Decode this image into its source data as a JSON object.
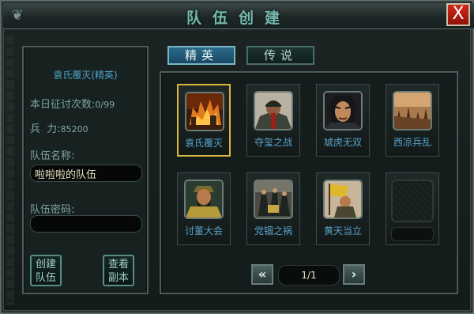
{
  "window": {
    "title": "队伍创建",
    "close_label": "X",
    "corner_icon": "dragon-ornament-icon"
  },
  "tabs": [
    {
      "label": "精英",
      "selected": true
    },
    {
      "label": "传说",
      "selected": false
    }
  ],
  "info": {
    "dungeon_name": "袁氏覆灭(精英)",
    "daily_label": "本日征讨次数:",
    "daily_value": "0/99",
    "troops_label": "兵  力:",
    "troops_value": "85200",
    "team_name_label": "队伍名称:",
    "team_name_value": "啦啦啦的队伍",
    "team_password_label": "队伍密码:",
    "team_password_value": "",
    "create_button_line1": "创建",
    "create_button_line2": "队伍",
    "view_button_line1": "查看",
    "view_button_line2": "副本"
  },
  "dungeons": [
    {
      "name": "袁氏覆灭",
      "selected": true,
      "icon": "burning-city-icon"
    },
    {
      "name": "夺玺之战",
      "selected": false,
      "icon": "armored-general-icon"
    },
    {
      "name": "虓虎无双",
      "selected": false,
      "icon": "warrior-portrait-icon"
    },
    {
      "name": "西凉兵乱",
      "selected": false,
      "icon": "soldiers-battle-icon"
    },
    {
      "name": "讨董大会",
      "selected": false,
      "icon": "bearded-general-icon"
    },
    {
      "name": "党锢之祸",
      "selected": false,
      "icon": "officials-court-icon"
    },
    {
      "name": "黄天当立",
      "selected": false,
      "icon": "yellow-banner-icon"
    },
    {
      "name": "",
      "selected": false,
      "icon": "locked-slot-icon"
    }
  ],
  "pagination": {
    "page_text": "1/1",
    "prev_icon": "double-chevron-left-icon",
    "next_icon": "chevron-right-icon"
  },
  "colors": {
    "accent_title": "#79b7b0",
    "selected_border": "#d9b83a",
    "caption_blue": "#5aa0c8",
    "close_red": "#c21f10"
  }
}
